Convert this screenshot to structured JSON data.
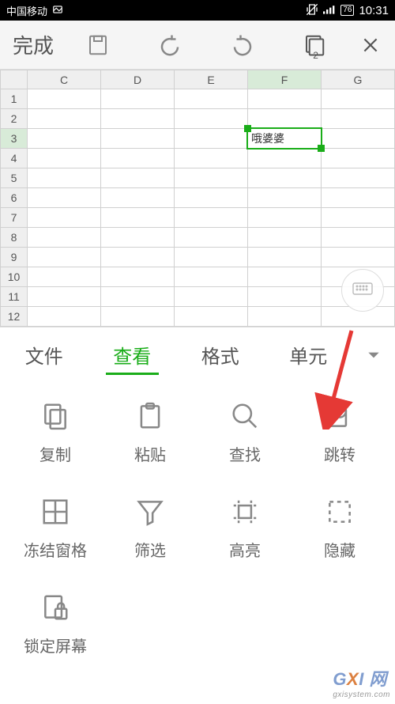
{
  "status": {
    "carrier": "中国移动",
    "battery": "76",
    "time": "10:31"
  },
  "toolbar": {
    "done_label": "完成",
    "doc_badge": "2"
  },
  "sheet": {
    "columns": [
      "C",
      "D",
      "E",
      "F",
      "G"
    ],
    "rows": [
      "1",
      "2",
      "3",
      "4",
      "5",
      "6",
      "7",
      "8",
      "9",
      "10",
      "11",
      "12"
    ],
    "active_col": "F",
    "active_row": "3",
    "cell_value": "哦婆婆"
  },
  "tabs": {
    "items": [
      "文件",
      "查看",
      "格式",
      "单元"
    ],
    "active_index": 1
  },
  "tools": {
    "row1": [
      {
        "name": "copy",
        "label": "复制"
      },
      {
        "name": "paste",
        "label": "粘贴"
      },
      {
        "name": "find",
        "label": "查找"
      },
      {
        "name": "goto",
        "label": "跳转"
      }
    ],
    "row2": [
      {
        "name": "freeze",
        "label": "冻结窗格"
      },
      {
        "name": "filter",
        "label": "筛选"
      },
      {
        "name": "highlight",
        "label": "高亮"
      },
      {
        "name": "hide",
        "label": "隐藏"
      }
    ],
    "row3": [
      {
        "name": "lock",
        "label": "锁定屏幕"
      }
    ]
  },
  "watermark": {
    "prefix": "G",
    "mid": "X",
    "suffix": "I 网",
    "sub": "gxisystem.com"
  }
}
